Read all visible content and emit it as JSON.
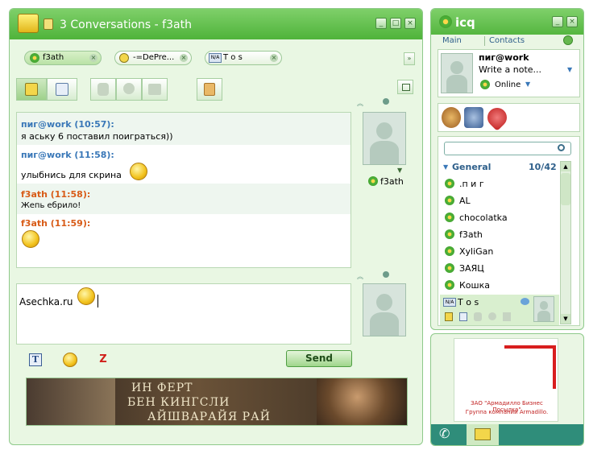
{
  "chat": {
    "title": "3 Conversations - f3ath",
    "tabs": [
      {
        "label": "f3ath"
      },
      {
        "label": "-=DePre..."
      },
      {
        "label": "T o s"
      }
    ],
    "messages": [
      {
        "name": "пиг@work (10:57):",
        "text": "я аську 6 поставил поиграться))",
        "color": "#3a78b8"
      },
      {
        "name": "пиг@work (11:58):",
        "text": "улыбнись для скрина",
        "color": "#3a78b8"
      },
      {
        "name": "f3ath (11:58):",
        "text": "Жепь ебрило!",
        "color": "#d85b17"
      },
      {
        "name": "f3ath (11:59):",
        "text": "",
        "color": "#d85b17"
      }
    ],
    "contact_name": "f3ath",
    "input_value": "Asechka.ru",
    "send_label": "Send",
    "banner": {
      "line1": "ИН ФЕРТ",
      "line2": "БЕН КИНГСЛИ",
      "line3": "АЙШВАРАЙЯ РАЙ"
    }
  },
  "icq": {
    "title": "icq",
    "nav_main": "Main",
    "nav_contacts": "Contacts",
    "user_name": "пиг@work",
    "note_placeholder": "Write a note...",
    "status": "Online",
    "group_name": "General",
    "group_count": "10/42",
    "contacts": [
      ".п и г",
      "AL",
      "chocolatka",
      "f3ath",
      "XyliGan",
      "ЗАЯЦ",
      "Кошка",
      "T o s"
    ]
  },
  "ad": {
    "line1": "ЗАО \"Армадилло Бизнес Посылка\"",
    "line2": "Группа компаний Armadillo."
  },
  "colors": {
    "accent_green": "#4fb33a",
    "name_blue": "#3a78b8",
    "name_orange": "#d85b17"
  }
}
